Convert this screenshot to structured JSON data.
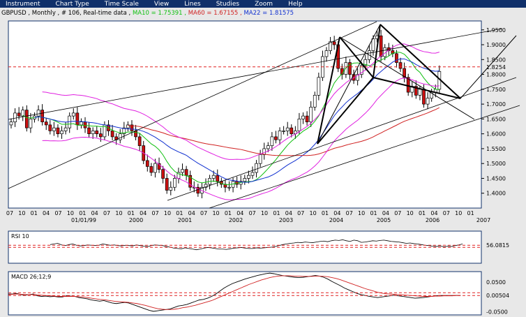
{
  "menu": [
    "Instrument",
    "Chart Type",
    "Time Scale",
    "View",
    "Lines",
    "Studies",
    "Zoom",
    "Help"
  ],
  "header": {
    "instrument": "GBPUSD , Monthly , # 106, Real-time data",
    "ma10": "MA10 = 1.75391",
    "ma60": "MA60 = 1.67155",
    "ma22": "MA22 = 1.81575"
  },
  "colors": {
    "up": "#ffffff",
    "down": "#cc1010",
    "ma10": "#10c010",
    "ma60": "#d02020",
    "ma22": "#1030d0",
    "bands": "#e020e0",
    "ref": "#e02020",
    "panel_bg": "#ffffff",
    "frame": "#10306a"
  },
  "chart_data": [
    {
      "type": "candlestick",
      "ylim": [
        1.35,
        1.98
      ],
      "yticks": [
        1.95,
        1.9,
        1.85,
        1.8,
        1.75,
        1.7,
        1.65,
        1.6,
        1.55,
        1.5,
        1.45,
        1.4
      ],
      "ytick_labels": [
        "1.9500",
        "1.9000",
        "1.8500",
        "1.8000",
        "1.7500",
        "1.7000",
        "1.6500",
        "1.6000",
        "1.5500",
        "1.5000",
        "1.4500",
        "1.4000"
      ],
      "ref_line": {
        "value": 1.8254,
        "label": "1.8254"
      },
      "month_labels": [
        "07",
        "10",
        "01",
        "04",
        "07",
        "10",
        "01",
        "04",
        "07",
        "10",
        "01",
        "04",
        "07",
        "10",
        "01",
        "04",
        "07",
        "10",
        "01",
        "04",
        "07",
        "10",
        "01",
        "04",
        "07",
        "10",
        "01",
        "04",
        "07",
        "10",
        "01",
        "04",
        "07",
        "10",
        "01",
        "04",
        "07",
        "10",
        "01"
      ],
      "year_labels": [
        "01/01/99",
        "2000",
        "2001",
        "2002",
        "2003",
        "2004",
        "2005",
        "2006",
        "2007"
      ],
      "start": "1998-07",
      "close": [
        1.64,
        1.67,
        1.66,
        1.68,
        1.62,
        1.65,
        1.66,
        1.68,
        1.64,
        1.63,
        1.61,
        1.62,
        1.6,
        1.61,
        1.62,
        1.66,
        1.67,
        1.63,
        1.64,
        1.62,
        1.6,
        1.61,
        1.6,
        1.59,
        1.63,
        1.61,
        1.59,
        1.58,
        1.6,
        1.62,
        1.63,
        1.61,
        1.59,
        1.56,
        1.51,
        1.49,
        1.47,
        1.5,
        1.48,
        1.45,
        1.41,
        1.42,
        1.45,
        1.47,
        1.48,
        1.46,
        1.42,
        1.42,
        1.4,
        1.42,
        1.43,
        1.45,
        1.46,
        1.44,
        1.43,
        1.42,
        1.42,
        1.44,
        1.43,
        1.44,
        1.45,
        1.46,
        1.47,
        1.5,
        1.53,
        1.55,
        1.56,
        1.59,
        1.58,
        1.61,
        1.61,
        1.62,
        1.6,
        1.61,
        1.65,
        1.66,
        1.64,
        1.69,
        1.73,
        1.79,
        1.86,
        1.88,
        1.91,
        1.9,
        1.82,
        1.8,
        1.84,
        1.8,
        1.78,
        1.8,
        1.83,
        1.85,
        1.88,
        1.92,
        1.93,
        1.86,
        1.89,
        1.88,
        1.87,
        1.84,
        1.82,
        1.79,
        1.74,
        1.76,
        1.73,
        1.75,
        1.7,
        1.72,
        1.74,
        1.75,
        1.81
      ]
    },
    {
      "type": "line",
      "title": "RSI 10",
      "ref_line": {
        "value": 56.0815,
        "label": "56.0815"
      },
      "ylim": [
        0,
        100
      ],
      "values": [
        58,
        60,
        62,
        57,
        55,
        58,
        60,
        56,
        54,
        55,
        57,
        56,
        55,
        56,
        60,
        58,
        56,
        57,
        55,
        54,
        56,
        55,
        54,
        57,
        55,
        53,
        52,
        55,
        57,
        56,
        55,
        52,
        50,
        47,
        46,
        45,
        48,
        46,
        44,
        42,
        44,
        47,
        49,
        48,
        46,
        44,
        44,
        43,
        45,
        47,
        48,
        49,
        47,
        46,
        46,
        48,
        47,
        48,
        49,
        50,
        52,
        55,
        58,
        60,
        62,
        63,
        65,
        64,
        66,
        65,
        64,
        66,
        68,
        69,
        67,
        70,
        72,
        71,
        73,
        70,
        68,
        72,
        70,
        65,
        66,
        68,
        70,
        69,
        71,
        72,
        70,
        68,
        67,
        66,
        64,
        62,
        63,
        61,
        60,
        58,
        56,
        55,
        53,
        52,
        54,
        51,
        53,
        52,
        55,
        57,
        60
      ]
    },
    {
      "type": "line",
      "title": "MACD 26;12;9",
      "ref_line": {
        "value": 0.00504,
        "label": "0.00504"
      },
      "yticks": [
        0.05,
        -0.05
      ],
      "ytick_labels": [
        "0.0500",
        "-0.0500"
      ],
      "ylim": [
        -0.06,
        0.085
      ],
      "series": [
        {
          "color": "#000000",
          "values": [
            0.01,
            0.01,
            0.012,
            0.008,
            0.006,
            0.008,
            0.01,
            0.004,
            0.002,
            0.003,
            0.001,
            0.002,
            0.0,
            0.0,
            0.004,
            0.003,
            0.002,
            -0.002,
            -0.004,
            -0.006,
            -0.01,
            -0.012,
            -0.014,
            -0.012,
            -0.016,
            -0.02,
            -0.022,
            -0.02,
            -0.018,
            -0.02,
            -0.025,
            -0.03,
            -0.035,
            -0.04,
            -0.045,
            -0.048,
            -0.046,
            -0.044,
            -0.042,
            -0.04,
            -0.035,
            -0.03,
            -0.028,
            -0.025,
            -0.02,
            -0.015,
            -0.01,
            -0.008,
            -0.004,
            0.002,
            0.01,
            0.02,
            0.03,
            0.038,
            0.045,
            0.05,
            0.055,
            0.06,
            0.064,
            0.068,
            0.072,
            0.075,
            0.078,
            0.08,
            0.078,
            0.075,
            0.072,
            0.07,
            0.068,
            0.066,
            0.065,
            0.066,
            0.068,
            0.07,
            0.072,
            0.07,
            0.066,
            0.06,
            0.052,
            0.045,
            0.038,
            0.03,
            0.024,
            0.018,
            0.012,
            0.008,
            0.005,
            0.002,
            0.0,
            -0.002,
            0.0,
            0.002,
            0.004,
            0.006,
            0.004,
            0.002,
            0.0,
            -0.002,
            -0.004,
            -0.003,
            -0.002,
            0.0,
            0.002,
            0.004,
            0.005,
            0.005,
            0.005,
            0.005,
            0.005,
            0.005
          ]
        },
        {
          "color": "#d02020",
          "values": [
            0.008,
            0.009,
            0.01,
            0.009,
            0.008,
            0.008,
            0.008,
            0.007,
            0.006,
            0.005,
            0.004,
            0.003,
            0.002,
            0.002,
            0.002,
            0.002,
            0.002,
            0.001,
            0.0,
            -0.002,
            -0.004,
            -0.006,
            -0.008,
            -0.009,
            -0.011,
            -0.013,
            -0.015,
            -0.016,
            -0.017,
            -0.018,
            -0.02,
            -0.022,
            -0.025,
            -0.028,
            -0.032,
            -0.036,
            -0.039,
            -0.041,
            -0.042,
            -0.042,
            -0.041,
            -0.039,
            -0.036,
            -0.034,
            -0.031,
            -0.028,
            -0.024,
            -0.02,
            -0.016,
            -0.012,
            -0.006,
            0.0,
            0.006,
            0.012,
            0.018,
            0.024,
            0.03,
            0.036,
            0.042,
            0.047,
            0.052,
            0.057,
            0.061,
            0.065,
            0.068,
            0.07,
            0.071,
            0.071,
            0.071,
            0.07,
            0.07,
            0.069,
            0.069,
            0.069,
            0.07,
            0.07,
            0.069,
            0.068,
            0.065,
            0.062,
            0.058,
            0.053,
            0.048,
            0.043,
            0.038,
            0.033,
            0.028,
            0.024,
            0.02,
            0.016,
            0.013,
            0.011,
            0.01,
            0.009,
            0.008,
            0.007,
            0.006,
            0.005,
            0.004,
            0.003,
            0.002,
            0.002,
            0.002,
            0.003,
            0.003,
            0.004,
            0.004,
            0.004,
            0.005,
            0.005
          ]
        }
      ]
    }
  ]
}
